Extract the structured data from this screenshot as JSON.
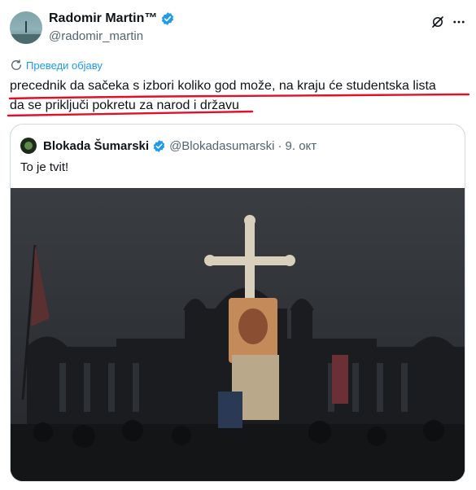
{
  "tweet": {
    "display_name": "Radomir Martin™",
    "handle": "@radomir_martin",
    "translate_label": "Преведи објаву",
    "text_line1": "precednik da sačeka s izbori koliko god može, na kraju će studentska lista",
    "text_line2": "da se priključi pokretu za narod i državu"
  },
  "quoted": {
    "display_name": "Blokada Šumarski",
    "handle": "@Blokadasumarski",
    "separator": "·",
    "date": "9. окт",
    "text": "To je tvit!"
  },
  "colors": {
    "accent": "#1d9bf0",
    "annotation_red": "#e0102a"
  },
  "icons": [
    "verified-badge-icon",
    "grok-icon",
    "more-icon",
    "translate-icon"
  ]
}
